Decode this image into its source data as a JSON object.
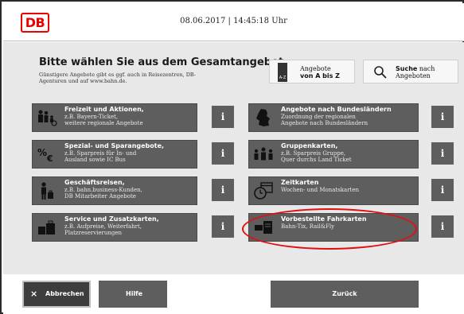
{
  "header": {
    "logo": "DB",
    "datetime": "08.06.2017 | 14:45:18 Uhr"
  },
  "main": {
    "title": "Bitte wählen Sie aus dem Gesamtangebot.",
    "subtitle": "Günstigere Angebote gibt es ggf. auch in Reisezentren, DB-Agenturen und auf www.bahn.de.",
    "az_button": {
      "line1": "Angebote",
      "line2": "von A bis Z",
      "icon_text": "A-Z"
    },
    "search_button": {
      "bold": "Suche",
      "rest1": " nach",
      "line2": "Angeboten"
    },
    "info_label": "i",
    "tiles_left": [
      {
        "title": "Freizeit und Aktionen,",
        "desc": "z.B. Bayern-Ticket,\nweitere regionale Angebote",
        "icon": "family-icon"
      },
      {
        "title": "Spezial- und Sparangebote,",
        "desc": "z.B. Sparpreis für In- und\nAusland sowie IC Bus",
        "icon": "percent-euro-icon"
      },
      {
        "title": "Geschäftsreisen,",
        "desc": "z.B. bahn.business-Kunden,\nDB Mitarbeiter Angebote",
        "icon": "business-traveler-icon"
      },
      {
        "title": "Service und Zusatzkarten,",
        "desc": "z.B. Aufpreise, Weiterfahrt,\nPlatzreservierungen",
        "icon": "service-icon"
      }
    ],
    "tiles_right": [
      {
        "title": "Angebote nach Bundesländern",
        "desc": "Zuordnung der regionalen\nAngebote nach Bundesländern",
        "icon": "germany-map-icon"
      },
      {
        "title": "Gruppenkarten,",
        "desc": "z.B. Sparpreis Gruppe,\nQuer durchs Land Ticket",
        "icon": "group-icon"
      },
      {
        "title": "Zeitkarten",
        "desc": "Wochen- und Monatskarten",
        "icon": "calendar-clock-icon"
      },
      {
        "title": "Vorbestellte Fahrkarten",
        "desc": "Bahn-Tix, Rail&Fly",
        "icon": "preordered-ticket-icon"
      }
    ]
  },
  "footer": {
    "cancel": "Abbrechen",
    "cancel_icon": "×",
    "help": "Hilfe",
    "back": "Zurück"
  },
  "colors": {
    "tile": "#5e5e5e",
    "background": "#e8e8e8",
    "brand_red": "#e00000",
    "highlight": "#e01010"
  }
}
